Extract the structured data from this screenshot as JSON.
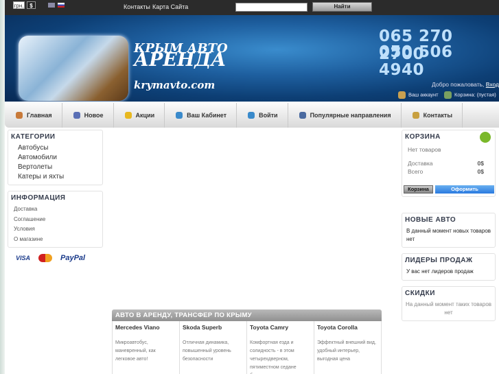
{
  "topbar": {
    "currency_uah": "грн.",
    "currency_usd": "$",
    "links": [
      "Контакты",
      "Карта Сайта"
    ],
    "search_placeholder": "",
    "search_button": "Найти"
  },
  "banner": {
    "logo_line1": "КРЫМ АВТО",
    "logo_line2": "АРЕНДА",
    "logo_site": "krymavto.com",
    "phone1": "065 270 2700",
    "phone2": "050 506 4940",
    "welcome": "Добро пожаловать,",
    "login_link": "Вход",
    "account": "Ваш аккаунт",
    "cart": "Корзина: (пустая)"
  },
  "nav": [
    {
      "label": "Главная",
      "icon": "home-icon",
      "color": "#c87a3a"
    },
    {
      "label": "Новое",
      "icon": "new-icon",
      "color": "#5a6fb5"
    },
    {
      "label": "Акции",
      "icon": "star-icon",
      "color": "#e8b820"
    },
    {
      "label": "Ваш Кабинет",
      "icon": "user-icon",
      "color": "#3a8acb"
    },
    {
      "label": "Войти",
      "icon": "login-icon",
      "color": "#3a8acb"
    },
    {
      "label": "Популярные направления",
      "icon": "car-icon",
      "color": "#4a6aa0"
    },
    {
      "label": "Контакты",
      "icon": "contacts-icon",
      "color": "#c8a040"
    }
  ],
  "categories": {
    "title": "КАТЕГОРИИ",
    "items": [
      "Автобусы",
      "Автомобили",
      "Вертолеты",
      "Катеры и яхты"
    ]
  },
  "information": {
    "title": "ИНФОРМАЦИЯ",
    "items": [
      "Доставка",
      "Соглашение",
      "Условия",
      "О магазине"
    ]
  },
  "payments": [
    "VISA",
    "MasterCard",
    "PayPal"
  ],
  "cart": {
    "title": "КОРЗИНА",
    "empty": "Нет товаров",
    "shipping_label": "Доставка",
    "shipping_value": "0$",
    "total_label": "Всего",
    "total_value": "0$",
    "cart_button": "Корзина",
    "checkout_button": "Оформить"
  },
  "new_products": {
    "title": "НОВЫЕ АВТО",
    "text": "В данный момент новых товаров нет"
  },
  "bestsellers": {
    "title": "ЛИДЕРЫ ПРОДАЖ",
    "text": "У вас нет лидеров продаж"
  },
  "specials": {
    "title": "СКИДКИ",
    "text": "На данный момент таких товаров нет"
  },
  "products": {
    "title": "АВТО В АРЕНДУ, ТРАНСФЕР ПО КРЫМУ",
    "items": [
      {
        "name": "Mercedes Viano",
        "desc": "Микроавтобус, маневренный, как легковое авто!"
      },
      {
        "name": "Skoda Superb",
        "desc": "Отличная динамика, повышенный уровень безопасности"
      },
      {
        "name": "Toyota Camry",
        "desc": "Комфортная езда и солидность - в этом четырехдверном, пятиместном седане бизнес-класса"
      },
      {
        "name": "Toyota Corolla",
        "desc": "Эффектный внешний вид, удобный интерьер, выгодная цена"
      }
    ]
  }
}
